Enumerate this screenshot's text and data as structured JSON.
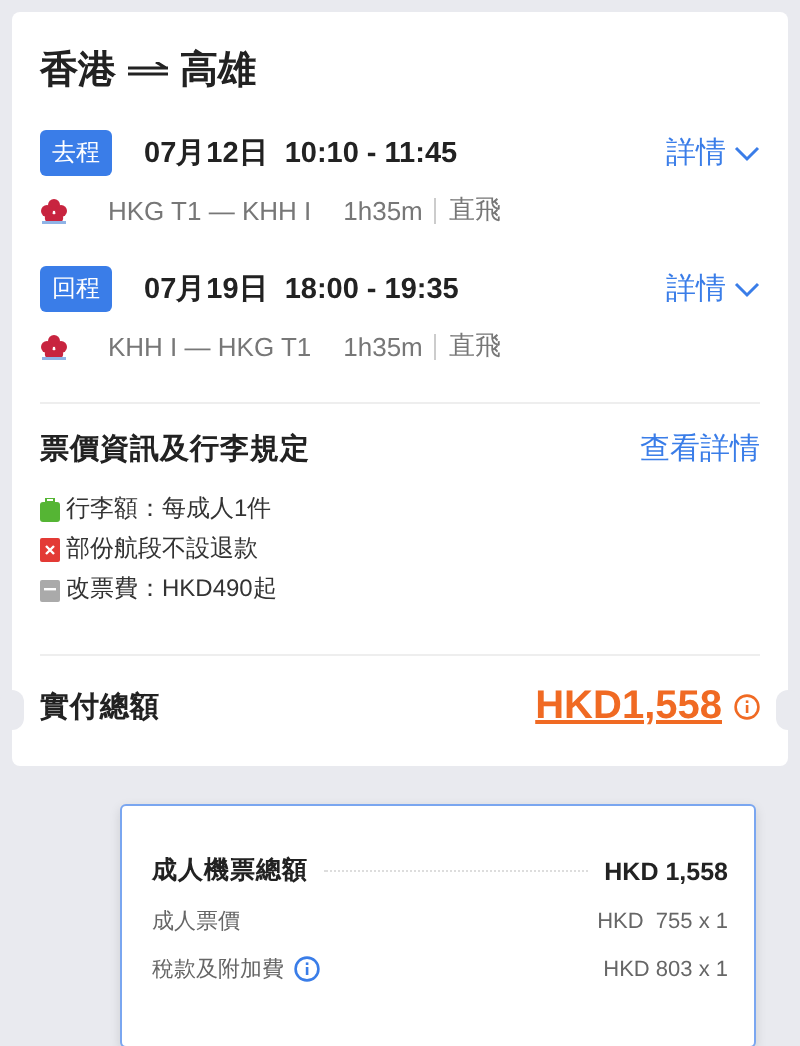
{
  "route": {
    "from": "香港",
    "to": "高雄"
  },
  "legs": [
    {
      "badge": "去程",
      "time": "07月12日  10:10 - 11:45",
      "details": "詳情",
      "path": "HKG T1 — KHH I",
      "duration": "1h35m",
      "stops": "直飛"
    },
    {
      "badge": "回程",
      "time": "07月19日  18:00 - 19:35",
      "details": "詳情",
      "path": "KHH I — HKG T1",
      "duration": "1h35m",
      "stops": "直飛"
    }
  ],
  "fare": {
    "title": "票價資訊及行李規定",
    "link": "查看詳情",
    "rules": [
      {
        "kind": "baggage",
        "text": "行李額：每成人1件"
      },
      {
        "kind": "refund",
        "text": "部份航段不設退款"
      },
      {
        "kind": "change",
        "text": "改票費：HKD490起"
      }
    ]
  },
  "total": {
    "label": "實付總額",
    "amount": "HKD1,558"
  },
  "breakdown": {
    "title": "成人機票總額",
    "amount": "HKD 1,558",
    "lines": [
      {
        "label": "成人票價",
        "value": "HKD  755 x 1",
        "info": false
      },
      {
        "label": "稅款及附加費",
        "value": "HKD 803 x 1",
        "info": true
      }
    ]
  }
}
